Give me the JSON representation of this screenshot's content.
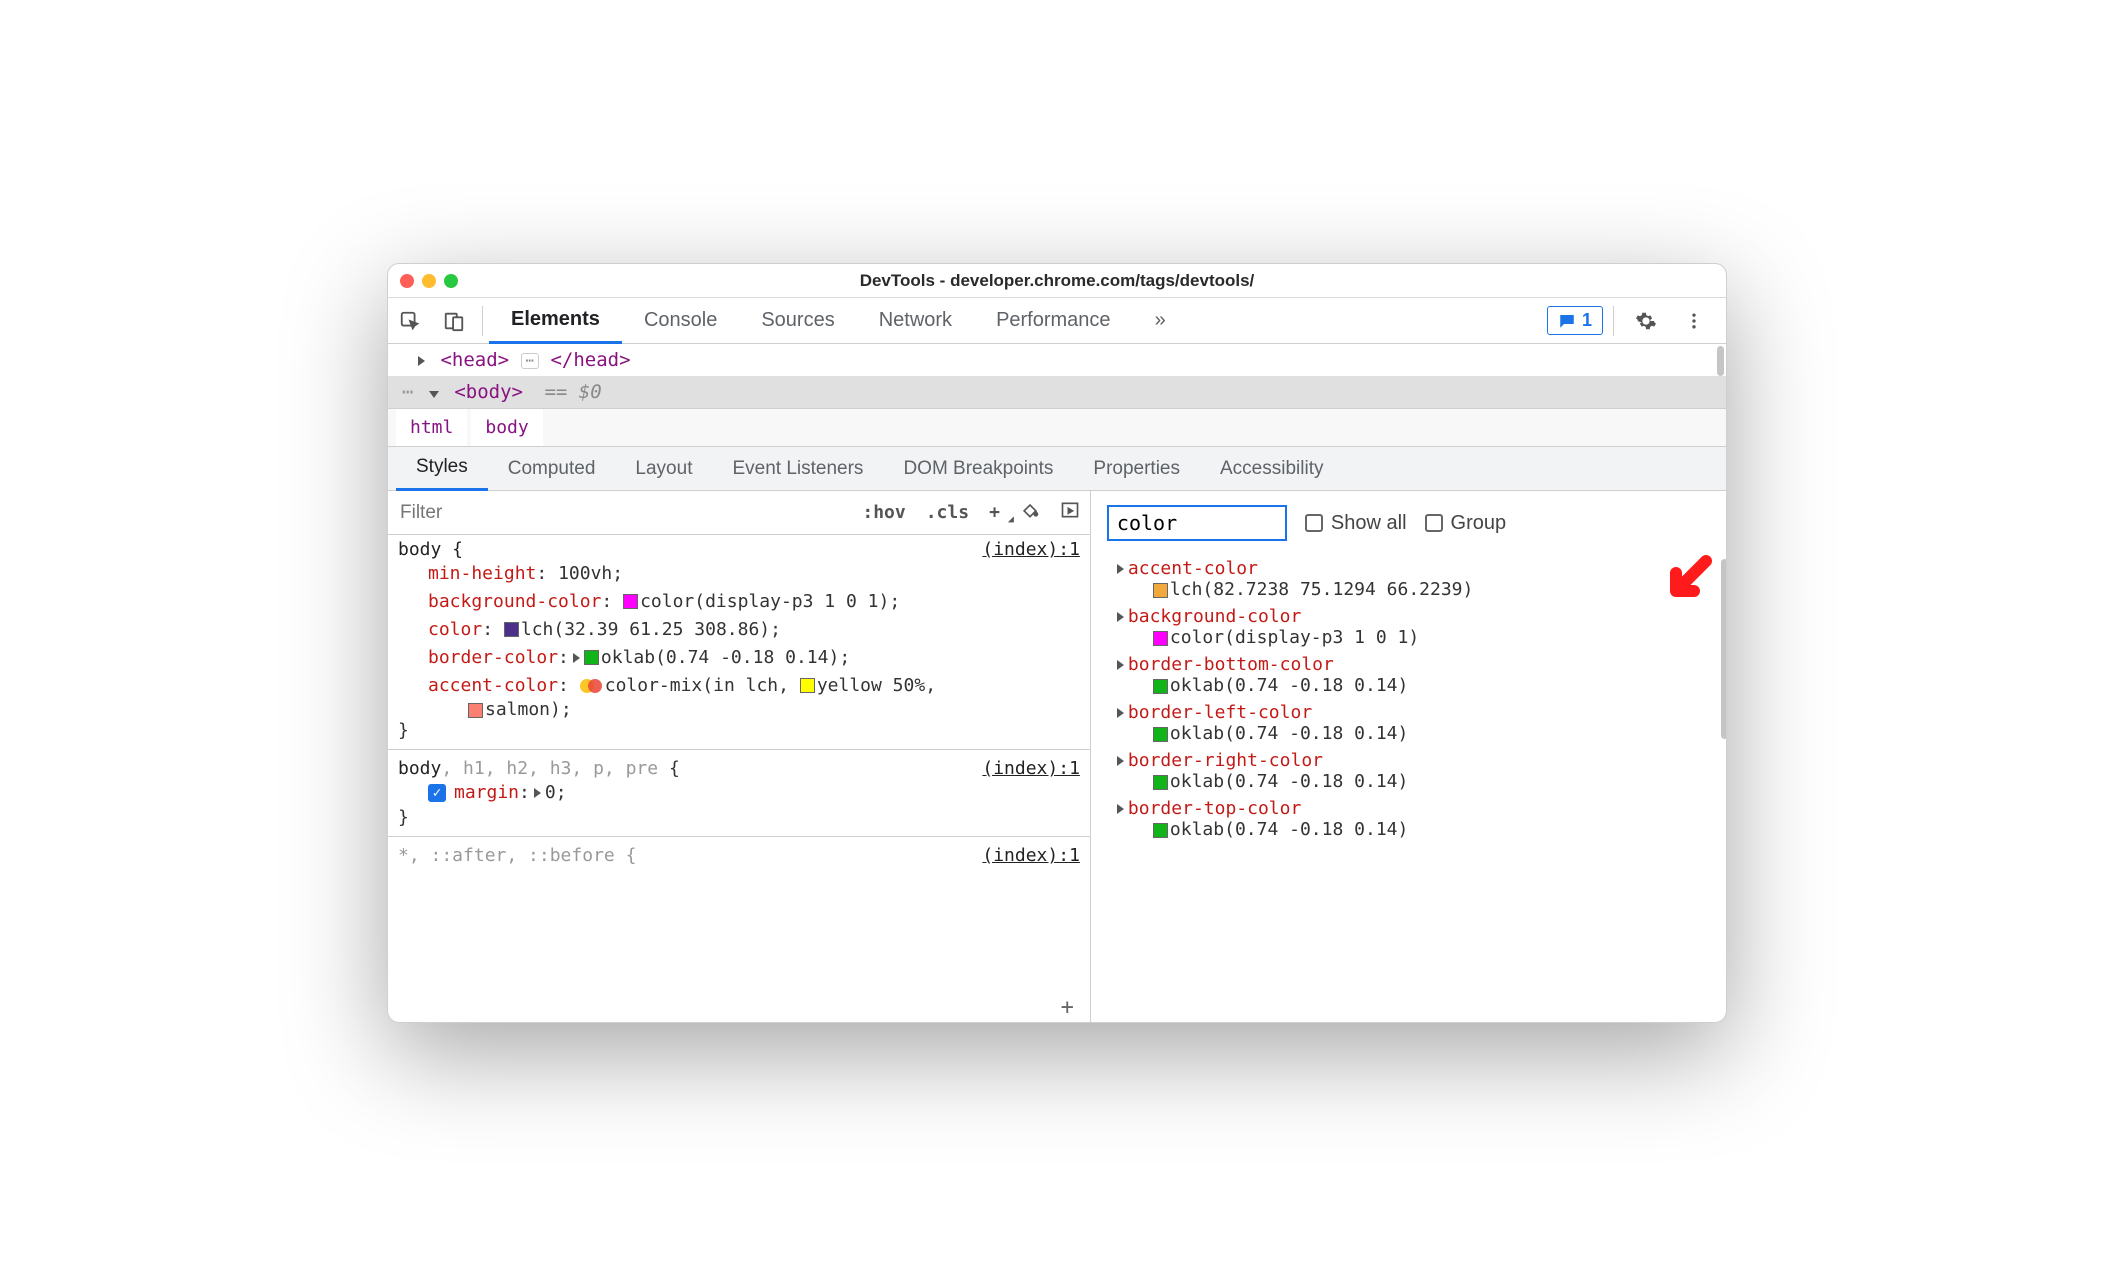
{
  "title": "DevTools - developer.chrome.com/tags/devtools/",
  "main_tabs": [
    "Elements",
    "Console",
    "Sources",
    "Network",
    "Performance"
  ],
  "main_tab_more": "»",
  "feedback_count": "1",
  "dom": {
    "head_open": "<head>",
    "head_close": "</head>",
    "body_open": "<body>",
    "eq": "== $0",
    "ellipsis_left": "…"
  },
  "crumbs": [
    "html",
    "body"
  ],
  "sub_tabs": [
    "Styles",
    "Computed",
    "Layout",
    "Event Listeners",
    "DOM Breakpoints",
    "Properties",
    "Accessibility"
  ],
  "filter_placeholder": "Filter",
  "filter_buttons": [
    ":hov",
    ".cls"
  ],
  "rules": {
    "r1": {
      "selector": "body {",
      "source": "(index):1",
      "d1_p": "min-height",
      "d1_v": "100vh",
      "d2_p": "background-color",
      "d2_v": "color(display-p3 1 0 1)",
      "d2_c": "#ff00ff",
      "d3_p": "color",
      "d3_v": "lch(32.39 61.25 308.86)",
      "d3_c": "#4b2f8b",
      "d4_p": "border-color",
      "d4_v": "oklab(0.74 -0.18 0.14)",
      "d4_c": "#11b419",
      "d5_p": "accent-color",
      "d5_v_a": "color-mix(in lch, ",
      "d5_mix_lbl": "yellow",
      "d5_mix_pct": " 50%,",
      "d5_mix_c": "#ffff00",
      "d5_line2": "salmon);",
      "d5_line2_c": "#fa8072",
      "close": "}"
    },
    "r2": {
      "selector_a": "body",
      "selector_b": ", h1, h2, h3, p, pre",
      " brace": " {",
      "source": "(index):1",
      "d1_p": "margin",
      "d1_v": "0",
      "close": "}"
    },
    "r3": {
      "selector": "*, ::after, ::before {",
      "source": "(index):1"
    }
  },
  "computed": {
    "filter_value": "color",
    "showall": "Show all",
    "group": "Group",
    "items": [
      {
        "name": "accent-color",
        "val": "lch(82.7238 75.1294 66.2239)",
        "c": "#f0a93a"
      },
      {
        "name": "background-color",
        "val": "color(display-p3 1 0 1)",
        "c": "#ff00ff"
      },
      {
        "name": "border-bottom-color",
        "val": "oklab(0.74 -0.18 0.14)",
        "c": "#11b419"
      },
      {
        "name": "border-left-color",
        "val": "oklab(0.74 -0.18 0.14)",
        "c": "#11b419"
      },
      {
        "name": "border-right-color",
        "val": "oklab(0.74 -0.18 0.14)",
        "c": "#11b419"
      },
      {
        "name": "border-top-color",
        "val": "oklab(0.74 -0.18 0.14)",
        "c": "#11b419"
      }
    ]
  }
}
